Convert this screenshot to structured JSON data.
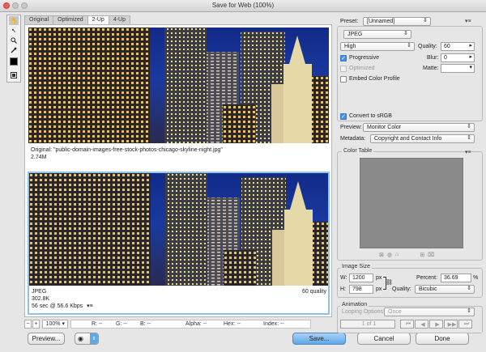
{
  "window": {
    "title": "Save for Web (100%)"
  },
  "colors": {
    "close": "#ec5f5b",
    "min": "#c7c7c7",
    "max": "#c7c7c7",
    "accent": "#8fc3ec"
  },
  "tools": [
    {
      "name": "hand-tool-icon",
      "glyph": "✋"
    },
    {
      "name": "slice-select-tool-icon",
      "glyph": "↖"
    },
    {
      "name": "zoom-tool-icon",
      "glyph": "🔍"
    },
    {
      "name": "eyedropper-tool-icon",
      "glyph": "✎"
    }
  ],
  "tabs": [
    "Original",
    "Optimized",
    "2-Up",
    "4-Up"
  ],
  "pane_original": {
    "line1": "Original: \"public-domain-images-free-stock-photos-chicago-skyline-night.jpg\"",
    "line2": "2.74M"
  },
  "pane_optimized": {
    "format": "JPEG",
    "size": "302.8K",
    "time": "56 sec @ 56.6 Kbps",
    "quality": "60 quality"
  },
  "statusbar": {
    "zoom": "100%",
    "r": "R: --",
    "g": "G: --",
    "b": "B: --",
    "alpha": "Alpha: --",
    "hex": "Hex: --",
    "index": "Index: --"
  },
  "buttons": {
    "preview": "Preview...",
    "save": "Save...",
    "cancel": "Cancel",
    "done": "Done"
  },
  "settings": {
    "preset_label": "Preset:",
    "preset_value": "[Unnamed]",
    "format": "JPEG",
    "compression": "High",
    "quality_label": "Quality:",
    "quality_value": "60",
    "progressive": "Progressive",
    "blur_label": "Blur:",
    "blur_value": "0",
    "optimized": "Optimized",
    "matte_label": "Matte:",
    "embed_profile": "Embed Color Profile",
    "convert_srgb": "Convert to sRGB",
    "preview_label": "Preview:",
    "preview_value": "Monitor Color",
    "metadata_label": "Metadata:",
    "metadata_value": "Copyright and Contact Info"
  },
  "color_table": {
    "title": "Color Table"
  },
  "image_size": {
    "title": "Image Size",
    "w_label": "W:",
    "w_value": "1200",
    "h_label": "H:",
    "h_value": "798",
    "unit": "px",
    "percent_label": "Percent:",
    "percent_value": "36.69",
    "percent_unit": "%",
    "quality_label": "Quality:",
    "quality_value": "Bicubic"
  },
  "animation": {
    "title": "Animation",
    "looping_label": "Looping Options:",
    "looping_value": "Once",
    "frame": "1 of 1"
  }
}
